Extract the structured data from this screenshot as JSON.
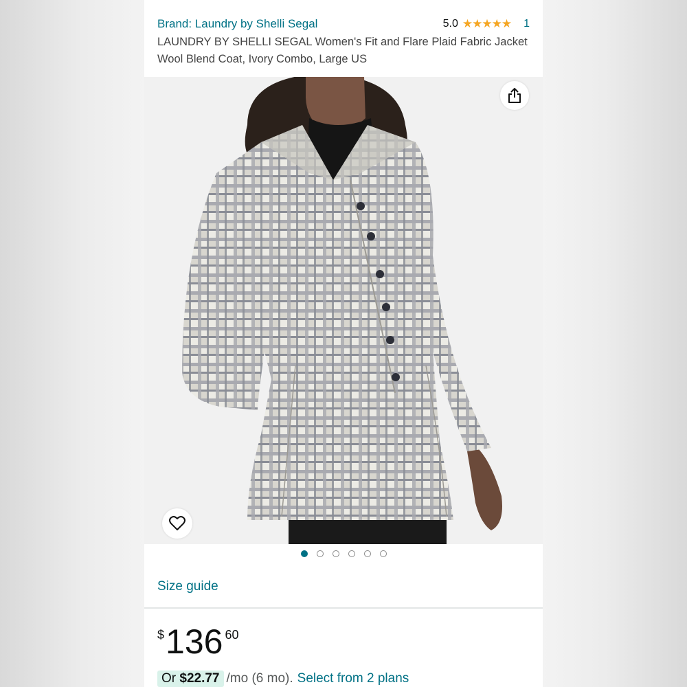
{
  "product": {
    "brand_link": "Brand: Laundry by Shelli Segal",
    "rating_value": "5.0",
    "rating_stars": "★★★★★",
    "rating_count": "1",
    "title": "LAUNDRY BY SHELLI SEGAL Women's Fit and Flare Plaid Fabric Jacket Wool Blend Coat, Ivory Combo, Large US"
  },
  "gallery": {
    "image_alt": "Model wearing ivory plaid fit and flare wool blend coat",
    "dots_total": 6,
    "active_index": 0
  },
  "size_guide_label": "Size guide",
  "price": {
    "symbol": "$",
    "whole": "136",
    "fraction": "60"
  },
  "installment": {
    "prefix": "Or",
    "amount": "$22.77",
    "suffix": "/mo (6 mo).",
    "link": "Select from 2 plans"
  },
  "colors": {
    "link": "#007185",
    "star": "#f5a623",
    "chip": "#d9f2ea"
  }
}
